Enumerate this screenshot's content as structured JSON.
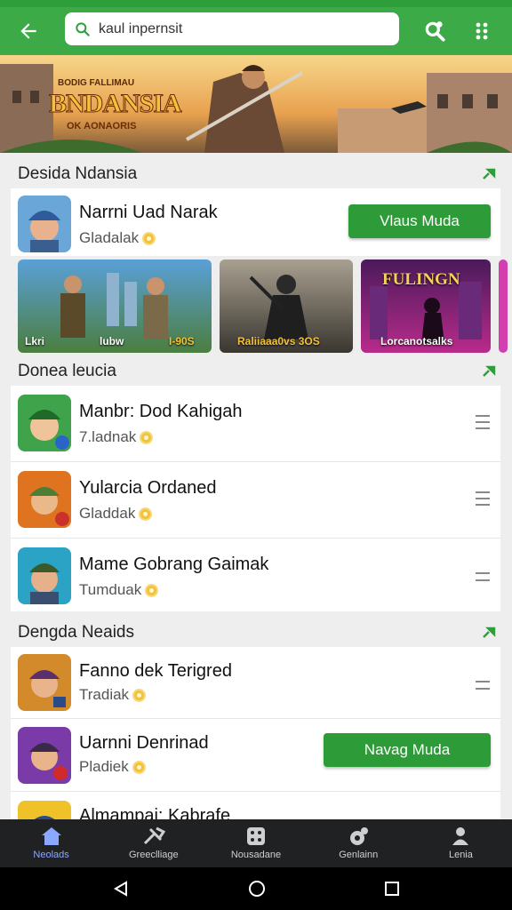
{
  "search": {
    "placeholder": "kaul inpernsit"
  },
  "banner": {
    "title": "BNDANSIA",
    "top_text": "BODIG FALLIMAU",
    "sub_text": "OK AONAORIS"
  },
  "sections": [
    {
      "title": "Desida Ndansia",
      "items": [
        {
          "name": "Narrni Uad Narak",
          "sub": "Gladalak",
          "button": "Vlaus Muda"
        }
      ],
      "thumbs": [
        {
          "caption_left": "Lkri",
          "caption_mid": "lubw",
          "caption_right": "I-90S"
        },
        {
          "caption": "Raliiaaa0vs 3OS"
        },
        {
          "title": "FULINGN",
          "caption": "Lorcanotsalks"
        }
      ]
    },
    {
      "title": "Donea leucia",
      "items": [
        {
          "name": "Manbr: Dod Kahigah",
          "sub": "7.ladnak"
        },
        {
          "name": "Yularcia Ordaned",
          "sub": "Gladdak"
        },
        {
          "name": "Mame Gobrang Gaimak",
          "sub": "Tumduak"
        }
      ]
    },
    {
      "title": "Dengda Neaids",
      "items": [
        {
          "name": "Fanno dek Terigred",
          "sub": "Tradiak"
        },
        {
          "name": "Uarnni Denrinad",
          "sub": "Pladiek",
          "button": "Navag Muda"
        },
        {
          "name": "Almampai: Kabrafe",
          "sub": ""
        }
      ]
    }
  ],
  "bottom_nav": [
    {
      "label": "Neolads",
      "icon": "home-icon",
      "active": true
    },
    {
      "label": "Greeclliage",
      "icon": "sword-icon",
      "active": false
    },
    {
      "label": "Nousadane",
      "icon": "dice-icon",
      "active": false
    },
    {
      "label": "Genlainn",
      "icon": "gamepad-icon",
      "active": false
    },
    {
      "label": "Lenia",
      "icon": "person-icon",
      "active": false
    }
  ],
  "colors": {
    "primary": "#3cab47",
    "button": "#2c9b38",
    "nav_bg": "#202123",
    "active_nav": "#8aa8ff"
  }
}
